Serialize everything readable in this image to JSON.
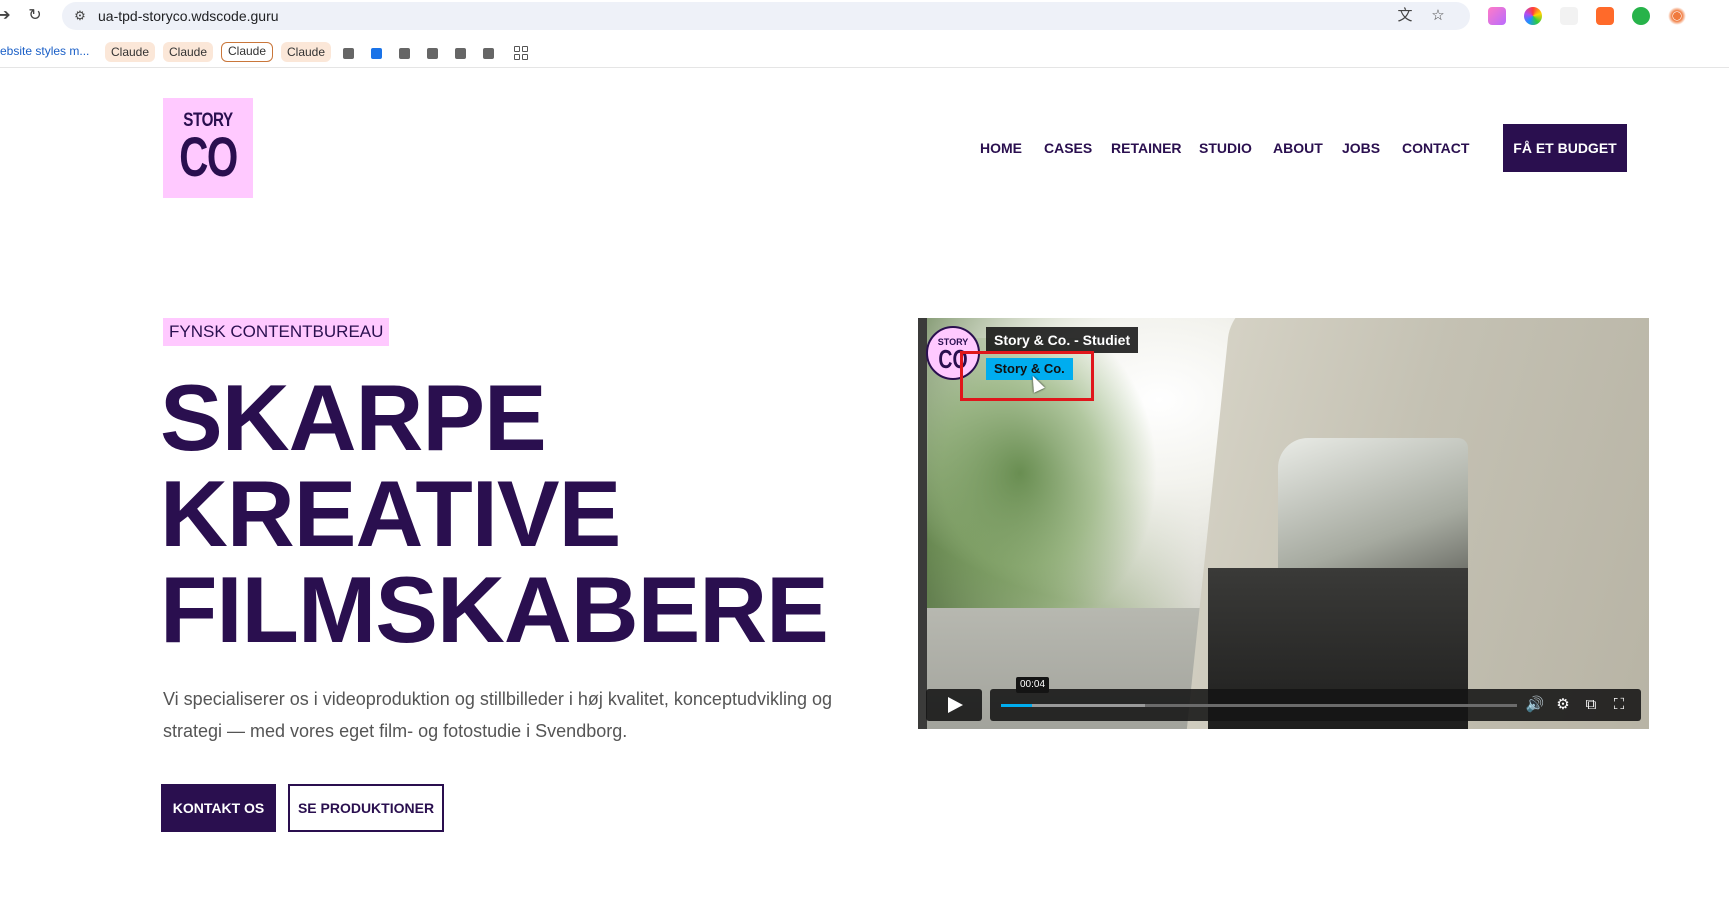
{
  "browser": {
    "url": "ua-tpd-storyco.wdscode.guru",
    "bookmarks": {
      "first": "ebsite styles m...",
      "chips": [
        "Claude",
        "Claude",
        "Claude",
        "Claude"
      ]
    },
    "icons": [
      "back-icon",
      "reload-icon",
      "site-info-icon",
      "translate-icon",
      "star-icon",
      "grid-icon"
    ]
  },
  "site": {
    "logo": {
      "top": "STORY",
      "bottom": "CO"
    },
    "nav": [
      "HOME",
      "CASES",
      "RETAINER",
      "STUDIO",
      "ABOUT",
      "JOBS",
      "CONTACT"
    ],
    "cta": "FÅ ET BUDGET",
    "colors": {
      "brand": "#2a0f4f",
      "accent": "#ffc9ff",
      "player": "#00adef"
    }
  },
  "hero": {
    "eyebrow": "FYNSK CONTENTBUREAU",
    "headline": [
      "SKARPE",
      "KREATIVE",
      "FILMSKABERE"
    ],
    "lead": "Vi specialiserer os i videoproduktion og stillbilleder i høj kvalitet, konceptudvikling og strategi — med vores eget film- og fotostudie i Svendborg.",
    "primary_button": "KONTAKT OS",
    "secondary_button": "SE PRODUKTIONER"
  },
  "video": {
    "avatar": {
      "top": "STORY",
      "bottom": "CO"
    },
    "title": "Story & Co. - Studiet",
    "channel": "Story & Co.",
    "current_time": "00:04",
    "progress_fraction": 0.06,
    "buffered_fraction": 0.28
  }
}
